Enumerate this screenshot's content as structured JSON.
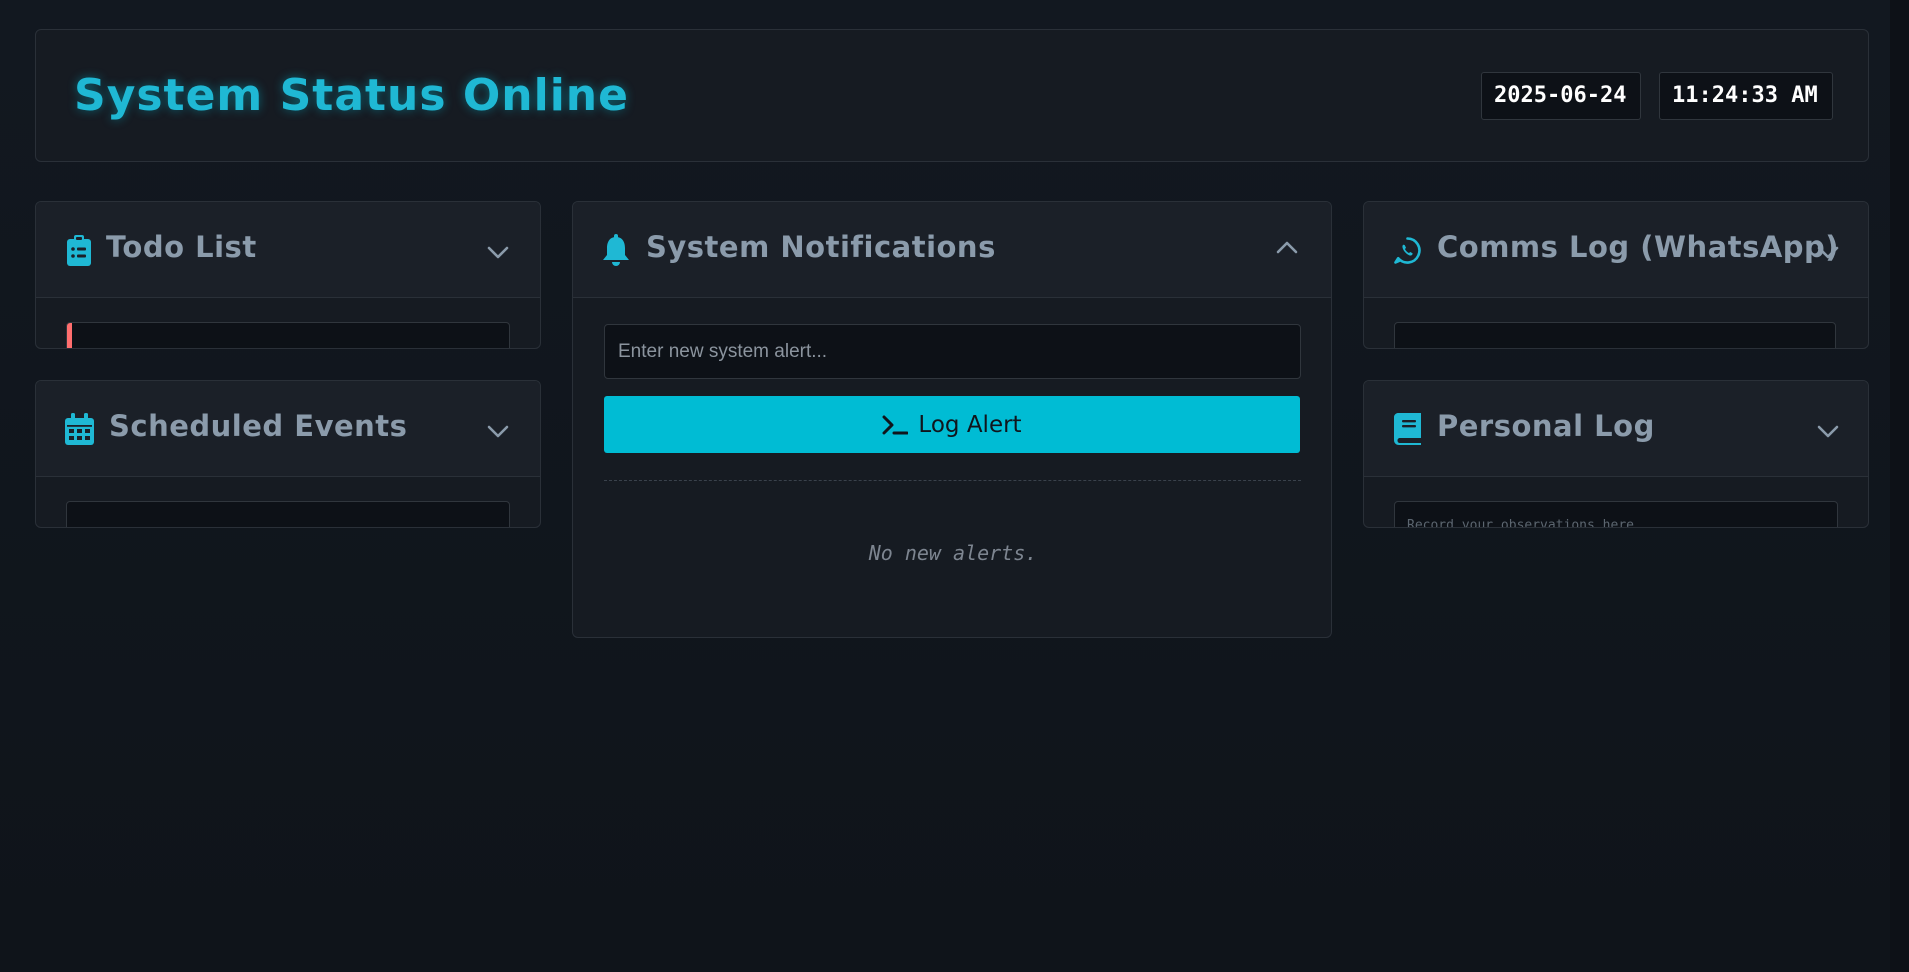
{
  "header": {
    "title": "System Status Online",
    "date": "2025-06-24",
    "time": "11:24:33 AM"
  },
  "panels": {
    "todo": {
      "title": "Todo List",
      "icon": "clipboard-list-icon",
      "expanded": false
    },
    "events": {
      "title": "Scheduled Events",
      "icon": "calendar-icon",
      "expanded": false
    },
    "notifications": {
      "title": "System Notifications",
      "icon": "bell-icon",
      "expanded": true,
      "input_placeholder": "Enter new system alert...",
      "button_label": "Log Alert",
      "empty_message": "No new alerts."
    },
    "comms": {
      "title": "Comms Log (WhatsApp)",
      "icon": "whatsapp-icon",
      "expanded": false
    },
    "personal": {
      "title": "Personal Log",
      "icon": "book-icon",
      "expanded": false,
      "placeholder": "Record your observations here..."
    }
  },
  "colors": {
    "accent": "#00bcd4",
    "background": "#10151c",
    "panel": "#161b22",
    "todo_priority": "#ff6e6e"
  }
}
